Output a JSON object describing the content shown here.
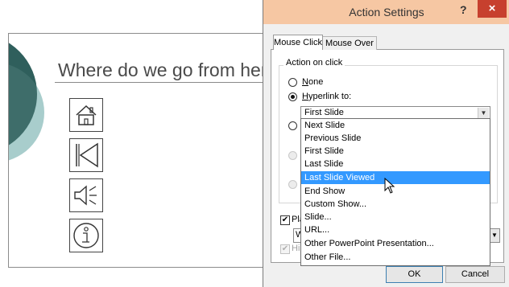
{
  "slide": {
    "title": "Where do we go from here?",
    "action_buttons": [
      {
        "icon": "home-icon"
      },
      {
        "icon": "back-to-beginning-icon"
      },
      {
        "icon": "sound-icon"
      },
      {
        "icon": "information-icon"
      }
    ],
    "colors": {
      "decor_dark": "#2f5f5c",
      "decor_light": "#9fc8c6"
    }
  },
  "dialog": {
    "title": "Action Settings",
    "help": "?",
    "close": "×",
    "tabs": [
      {
        "label": "Mouse Click",
        "active": true
      },
      {
        "label": "Mouse Over",
        "active": false
      }
    ],
    "group_label": "Action on click",
    "options": {
      "none": {
        "prefix": "N",
        "rest": "one",
        "checked": false
      },
      "hyperlink": {
        "prefix": "H",
        "rest": "yperlink to:",
        "checked": true
      }
    },
    "hyperlink_value": "First Slide",
    "dropdown_items": [
      "Next Slide",
      "Previous Slide",
      "First Slide",
      "Last Slide",
      "Last Slide Viewed",
      "End Show",
      "Custom Show...",
      "Slide...",
      "URL...",
      "Other PowerPoint Presentation...",
      "Other File..."
    ],
    "selected_dropdown_index": 4,
    "play_sound": {
      "label_fragment": "Pla",
      "checked": true
    },
    "sound_value_fragment": "W",
    "highlight": {
      "label_fragment": "Hi",
      "checked": true,
      "disabled": true
    },
    "buttons": {
      "ok": "OK",
      "cancel": "Cancel"
    },
    "colors": {
      "titlebar": "#f6c7a3",
      "close": "#c7402e",
      "selection": "#3399ff"
    }
  }
}
